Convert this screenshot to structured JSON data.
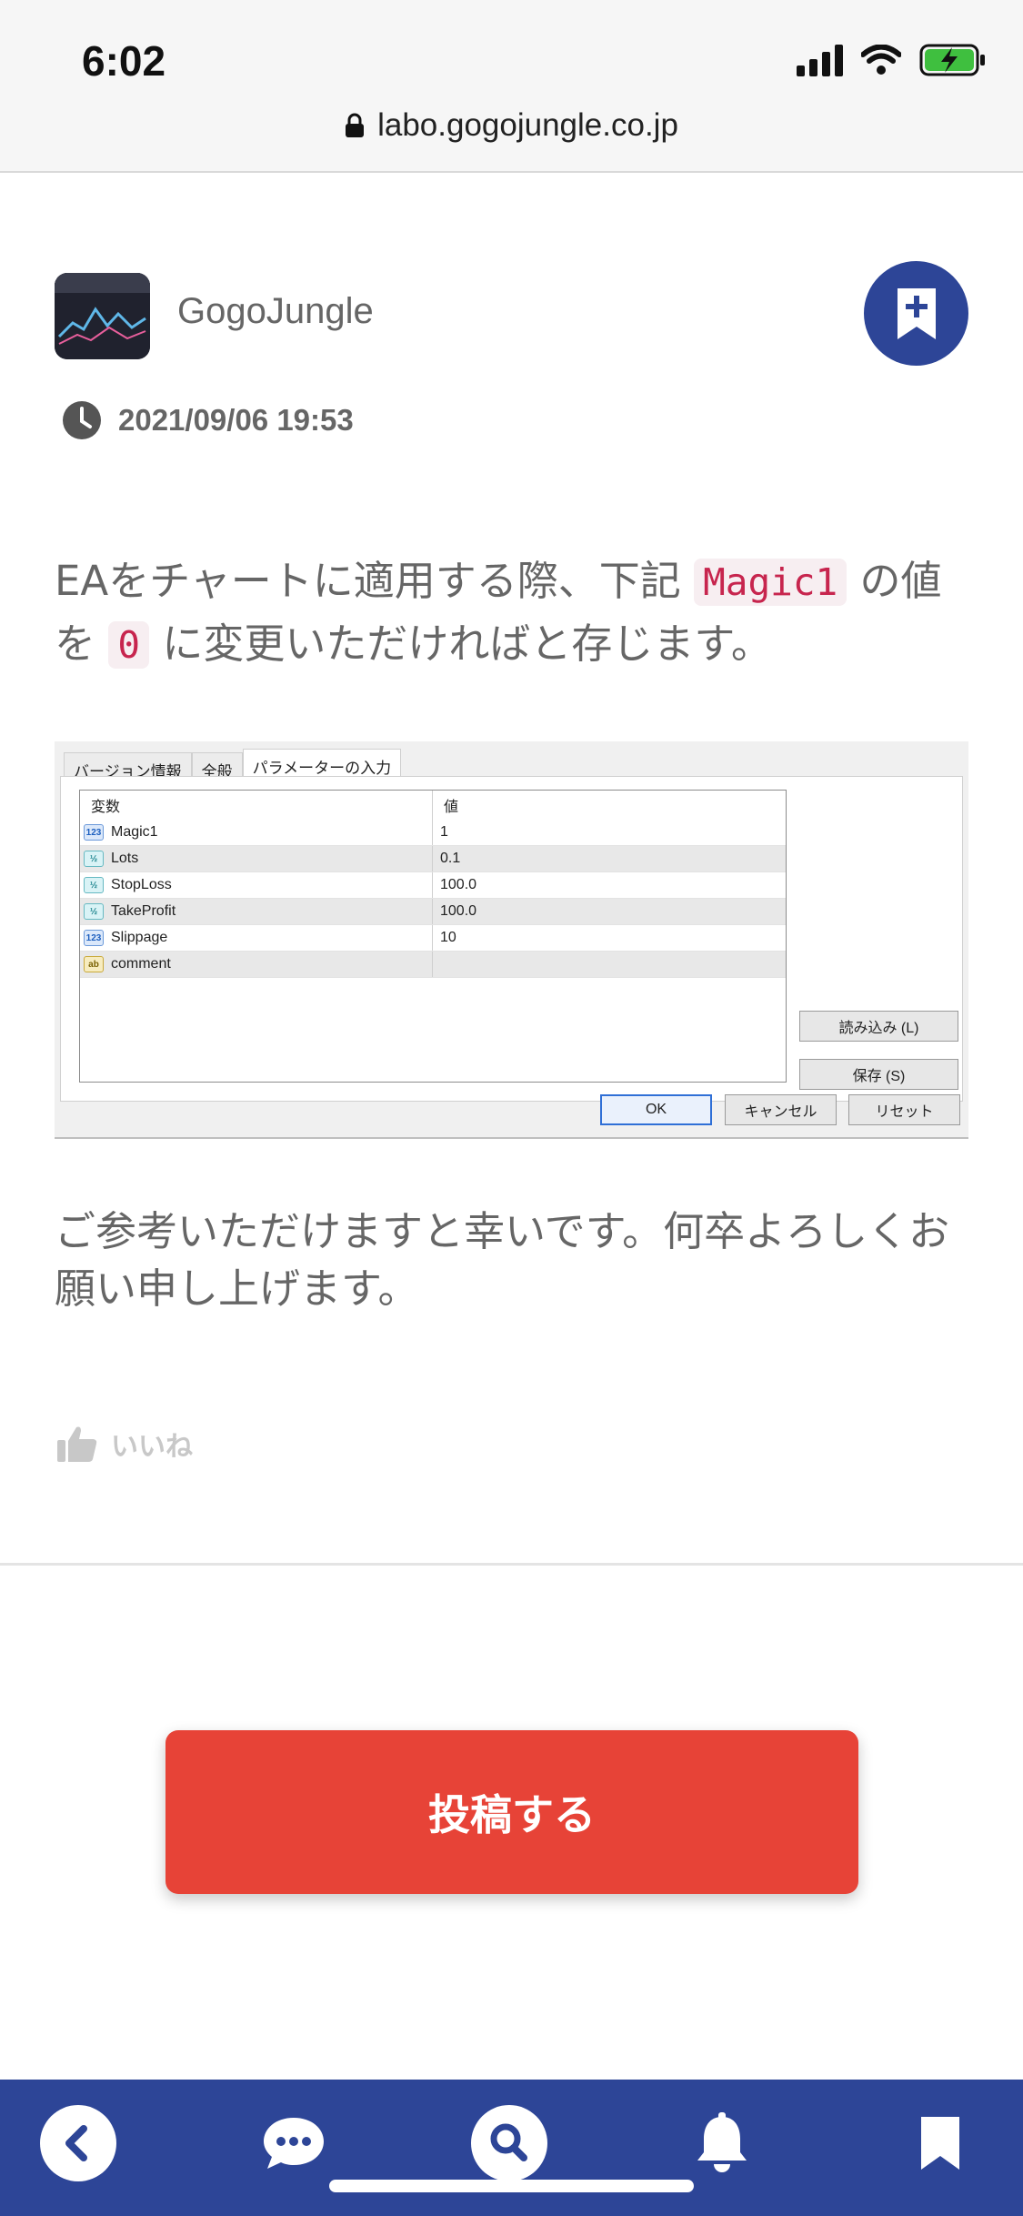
{
  "status_bar": {
    "time": "6:02",
    "icons": [
      "signal-icon",
      "wifi-icon",
      "battery-charging-icon"
    ],
    "battery_color": "#3fbf3f"
  },
  "browser": {
    "url": "labo.gogojungle.co.jp",
    "icon": "lock-icon"
  },
  "post": {
    "author": "GogoJungle",
    "date": "2021/09/06 19:53",
    "paragraph1": {
      "part1": "EAをチャートに適用する際、下記",
      "code1": "Magic1",
      "part2": "の値を",
      "code2": "0",
      "part3": "に変更いただければと存じます。"
    },
    "paragraph2": "ご参考いただけますと幸いです。何卒よろしくお願い申し上げます。",
    "like_label": "いいね"
  },
  "dialog_screenshot": {
    "tabs": [
      "バージョン情報",
      "全般",
      "パラメーターの入力"
    ],
    "active_tab": "パラメーターの入力",
    "columns": [
      "変数",
      "値"
    ],
    "rows": [
      {
        "type": "123",
        "name": "Magic1",
        "value": "1"
      },
      {
        "type": "½",
        "name": "Lots",
        "value": "0.1"
      },
      {
        "type": "½",
        "name": "StopLoss",
        "value": "100.0"
      },
      {
        "type": "½",
        "name": "TakeProfit",
        "value": "100.0"
      },
      {
        "type": "123",
        "name": "Slippage",
        "value": "10"
      },
      {
        "type": "ab",
        "name": "comment",
        "value": ""
      }
    ],
    "load_button": "読み込み (L)",
    "save_button": "保存 (S)",
    "ok_button": "OK",
    "cancel_button": "キャンセル",
    "reset_button": "リセット"
  },
  "post_button": "投稿する",
  "bottom_nav": {
    "items": [
      "back-icon",
      "chat-icon",
      "search-icon",
      "bell-icon",
      "bookmark-icon"
    ]
  },
  "colors": {
    "brand_blue": "#2d4597",
    "post_red": "#e74337",
    "code_red": "#c7254e"
  }
}
